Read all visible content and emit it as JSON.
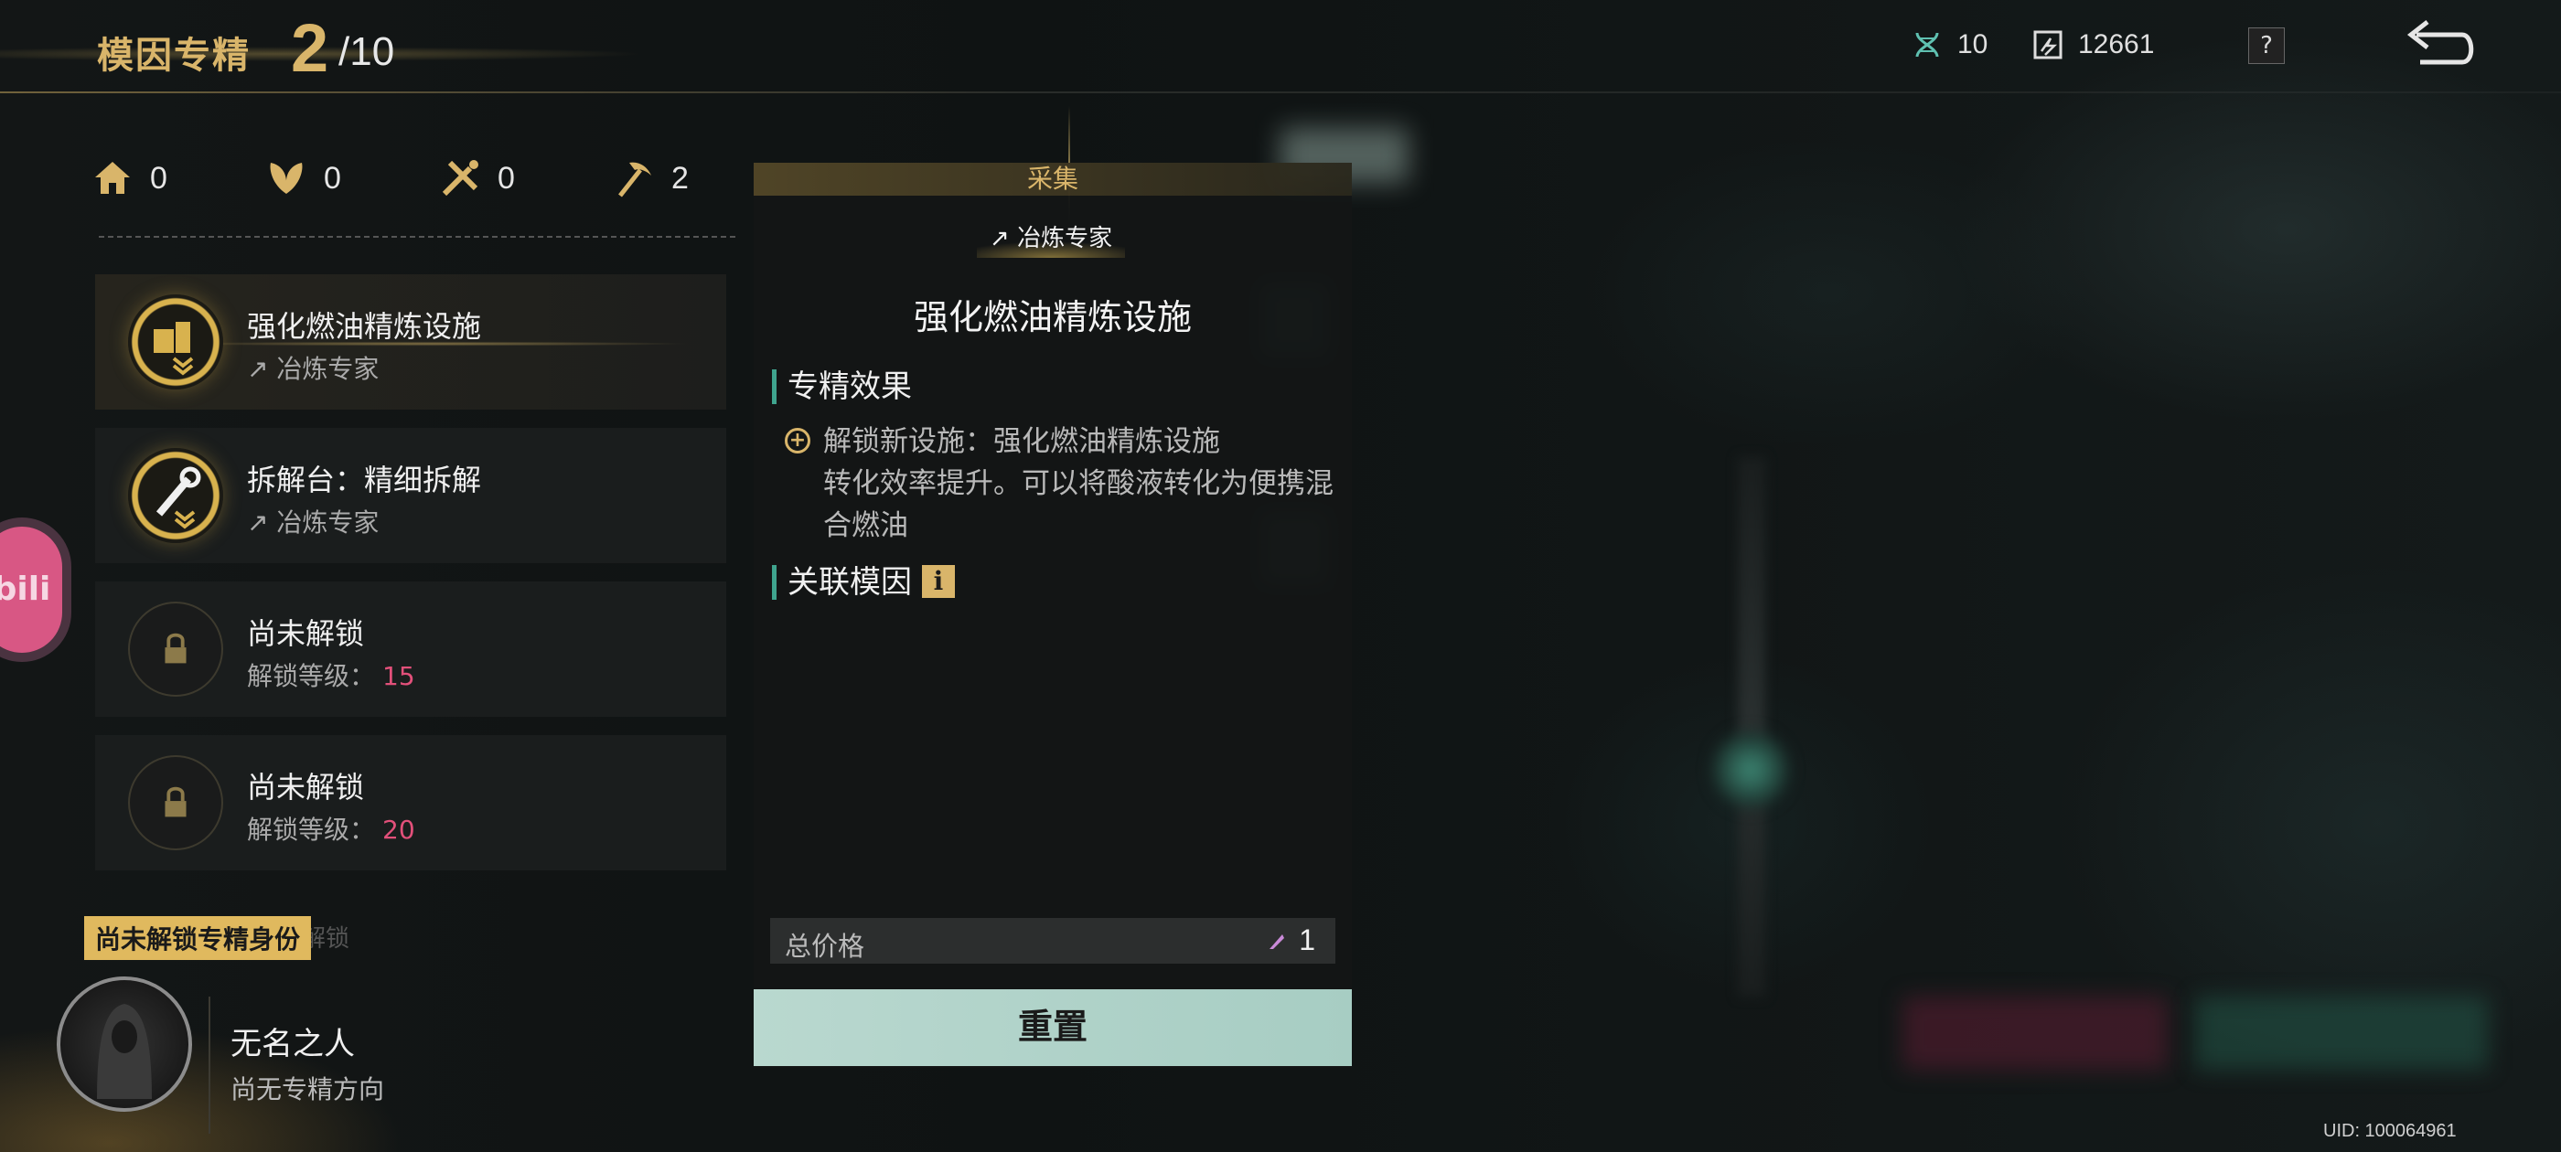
{
  "header": {
    "title": "模因专精",
    "level_current": "2",
    "level_max": "/10",
    "resource_gene": "10",
    "resource_chip": "12661",
    "help_label": "?"
  },
  "counts": [
    {
      "icon": "house-icon",
      "value": "0"
    },
    {
      "icon": "leaf-icon",
      "value": "0"
    },
    {
      "icon": "tools-icon",
      "value": "0"
    },
    {
      "icon": "pickaxe-icon",
      "value": "2"
    }
  ],
  "cards": [
    {
      "title": "强化燃油精炼设施",
      "sub": "冶炼专家",
      "icon": "fuel-refinery-icon",
      "locked": false
    },
    {
      "title": "拆解台：精细拆解",
      "sub": "冶炼专家",
      "icon": "dismantle-wrench-icon",
      "locked": false
    },
    {
      "title": "尚未解锁",
      "sub": "解锁等级：",
      "level": "15",
      "icon": "lock-icon",
      "locked": true
    },
    {
      "title": "尚未解锁",
      "sub": "解锁等级：",
      "level": "20",
      "icon": "lock-icon",
      "locked": true
    }
  ],
  "identity": {
    "tag": "尚未解锁专精身份",
    "faded": "解锁",
    "name": "无名之人",
    "direction": "尚无专精方向"
  },
  "bili_label": "bili",
  "panel": {
    "header": "采集",
    "spec_tag": "冶炼专家",
    "title": "强化燃油精炼设施",
    "effect_heading": "专精效果",
    "effect_line1": "解锁新设施：强化燃油精炼设施",
    "effect_line2": "转化效率提升。可以将酸液转化为便携混合燃油",
    "related_heading": "关联模因",
    "info_label": "i",
    "total_label": "总价格",
    "total_value": "1",
    "reset_label": "重置"
  },
  "uid": "UID: 100064961",
  "colors": {
    "gold": "#d9b56a",
    "accent_green": "#3fa48e",
    "lock_level": "#e2507a",
    "reset_bg": "#b9d8cf"
  }
}
